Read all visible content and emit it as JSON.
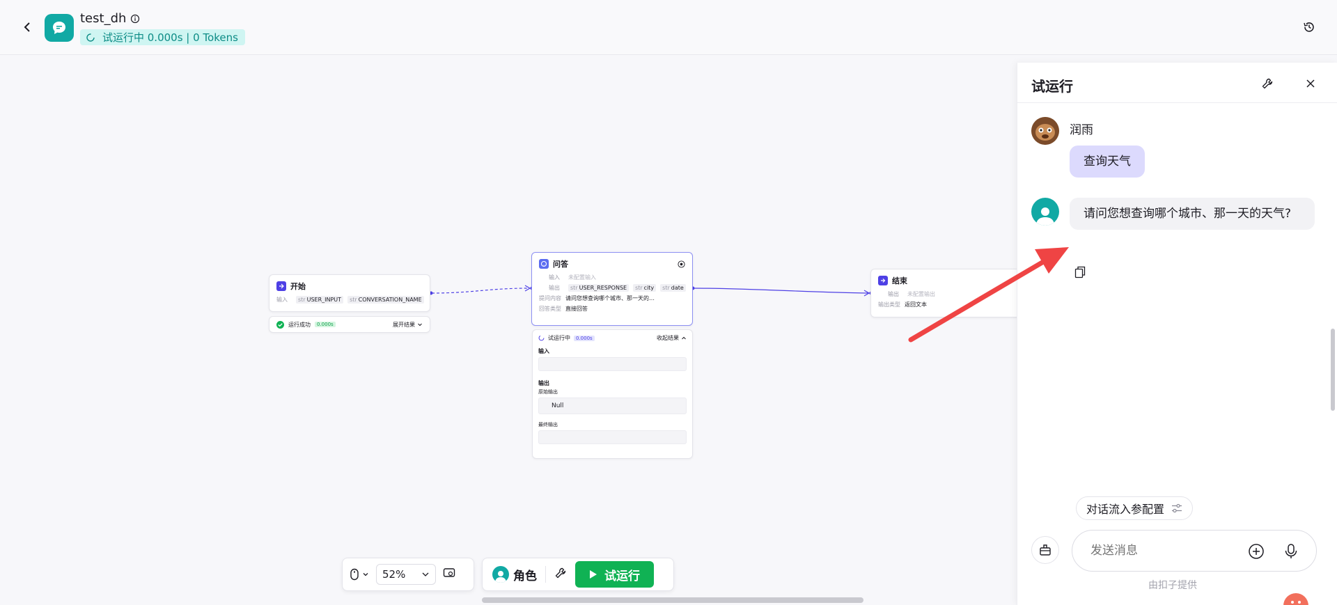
{
  "header": {
    "app_name": "test_dh",
    "run_status": "试运行中 0.000s | 0 Tokens"
  },
  "nodes": {
    "start": {
      "title": "开始",
      "input_label": "输入",
      "inputs": [
        {
          "type": "str",
          "name": "USER_INPUT"
        },
        {
          "type": "str",
          "name": "CONVERSATION_NAME"
        }
      ],
      "status_text": "运行成功",
      "status_time": "0.000s",
      "expand_label": "展开结果"
    },
    "qa": {
      "title": "问答",
      "input_label": "输入",
      "input_value": "未配置输入",
      "output_label": "输出",
      "outputs": [
        {
          "type": "str",
          "name": "USER_RESPONSE"
        },
        {
          "type": "str",
          "name": "city"
        },
        {
          "type": "str",
          "name": "date"
        }
      ],
      "question_label": "提问内容",
      "question_value": "请问您想查询哪个城市、那一天的…",
      "answer_type_label": "回答类型",
      "answer_type_value": "直接回答",
      "run_status": "试运行中",
      "run_time": "0.000s",
      "collapse_label": "收起结果",
      "section_input": "输入",
      "section_output": "输出",
      "raw_output_label": "原始输出",
      "raw_output_value": "Null",
      "final_output_label": "最终输出"
    },
    "end": {
      "title": "结束",
      "output_label": "输出",
      "output_value": "未配置输出",
      "output_type_label": "输出类型",
      "output_type_value": "返回文本"
    }
  },
  "toolbar": {
    "zoom": "52%",
    "role_label": "角色",
    "run_label": "试运行"
  },
  "side_panel": {
    "title": "试运行",
    "user_name": "润雨",
    "user_message": "查询天气",
    "bot_message": "请问您想查询哪个城市、那一天的天气?",
    "params_button": "对话流入参配置",
    "input_placeholder": "发送消息",
    "footer": "由扣子提供"
  },
  "colors": {
    "accent": "#4e40e5",
    "run_green": "#10b254",
    "user_bubble": "#dcdafd",
    "arrow_red": "#ef4444",
    "teal": "#11a9a4"
  }
}
